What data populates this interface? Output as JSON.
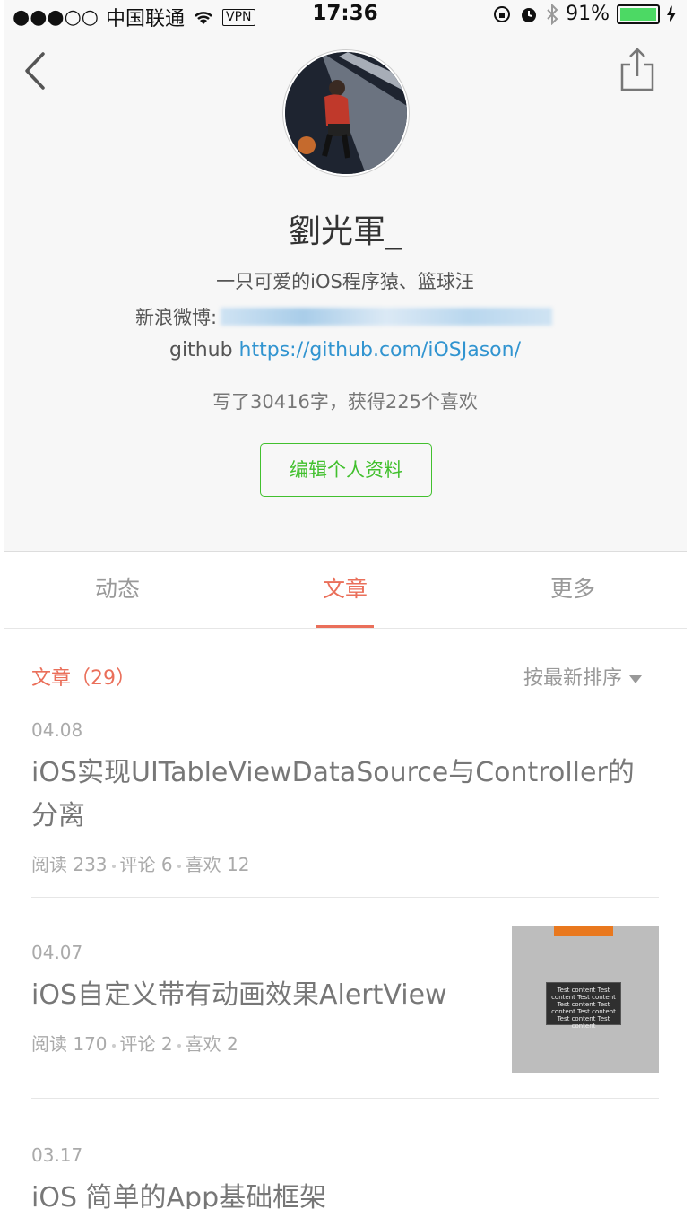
{
  "status_bar": {
    "signal": "●●●○○",
    "carrier": "中国联通",
    "vpn": "VPN",
    "time": "17:36",
    "battery": "91%"
  },
  "profile": {
    "name": "劉光軍_",
    "bio": "一只可爱的iOS程序猿、篮球汪",
    "weibo_label": "新浪微博:",
    "github_label": "github",
    "github_url": "https://github.com/iOSJason/",
    "stats": "写了30416字，获得225个喜欢",
    "edit_button": "编辑个人资料"
  },
  "tabs": [
    {
      "label": "动态",
      "active": false
    },
    {
      "label": "文章",
      "active": true
    },
    {
      "label": "更多",
      "active": false
    }
  ],
  "list": {
    "title": "文章（29）",
    "sort_label": "按最新排序"
  },
  "articles": [
    {
      "date": "04.08",
      "title": "iOS实现UITableViewDataSource与Controller的分离",
      "reads": "阅读 233",
      "comments": "评论 6",
      "likes": "喜欢 12"
    },
    {
      "date": "04.07",
      "title": "iOS自定义带有动画效果AlertView",
      "reads": "阅读 170",
      "comments": "评论 2",
      "likes": "喜欢 2",
      "thumb_text": "Test content Test content Test content Test content Test content Test content Test content Test content"
    },
    {
      "date": "03.17",
      "title": "iOS 简单的App基础框架"
    }
  ],
  "icons": {
    "back": "chevron-left-icon",
    "share": "share-icon"
  },
  "colors": {
    "accent": "#ea6f5a",
    "green": "#42c02e",
    "link": "#3194d0"
  }
}
